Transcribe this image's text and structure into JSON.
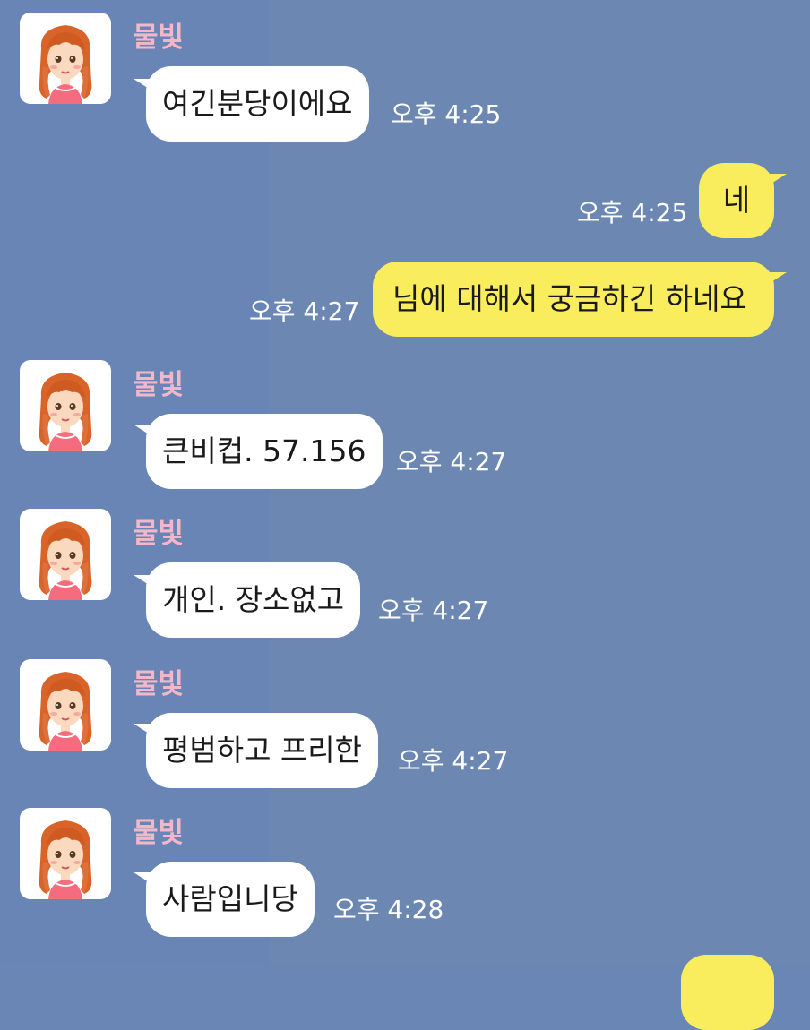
{
  "chat": {
    "messages": [
      {
        "sender": "물빛",
        "text": "여긴분당이에요",
        "time": "오후 4:25",
        "direction": "in"
      },
      {
        "text": "네",
        "time": "오후 4:25",
        "direction": "out"
      },
      {
        "text": "님에 대해서 궁금하긴 하네요",
        "time": "오후 4:27",
        "direction": "out"
      },
      {
        "sender": "물빛",
        "text": "큰비컵. 57.156",
        "time": "오후 4:27",
        "direction": "in"
      },
      {
        "sender": "물빛",
        "text": "개인. 장소없고",
        "time": "오후 4:27",
        "direction": "in"
      },
      {
        "sender": "물빛",
        "text": "평범하고 프리한",
        "time": "오후 4:27",
        "direction": "in"
      },
      {
        "sender": "물빛",
        "text": "사람입니당",
        "time": "오후 4:28",
        "direction": "in"
      }
    ]
  },
  "colors": {
    "background": "#6a86b4",
    "incoming_bubble": "#ffffff",
    "outgoing_bubble": "#f9ec5d",
    "sender_name": "#f2b8c9"
  },
  "icons": {
    "avatar": "girl-avatar-icon"
  }
}
